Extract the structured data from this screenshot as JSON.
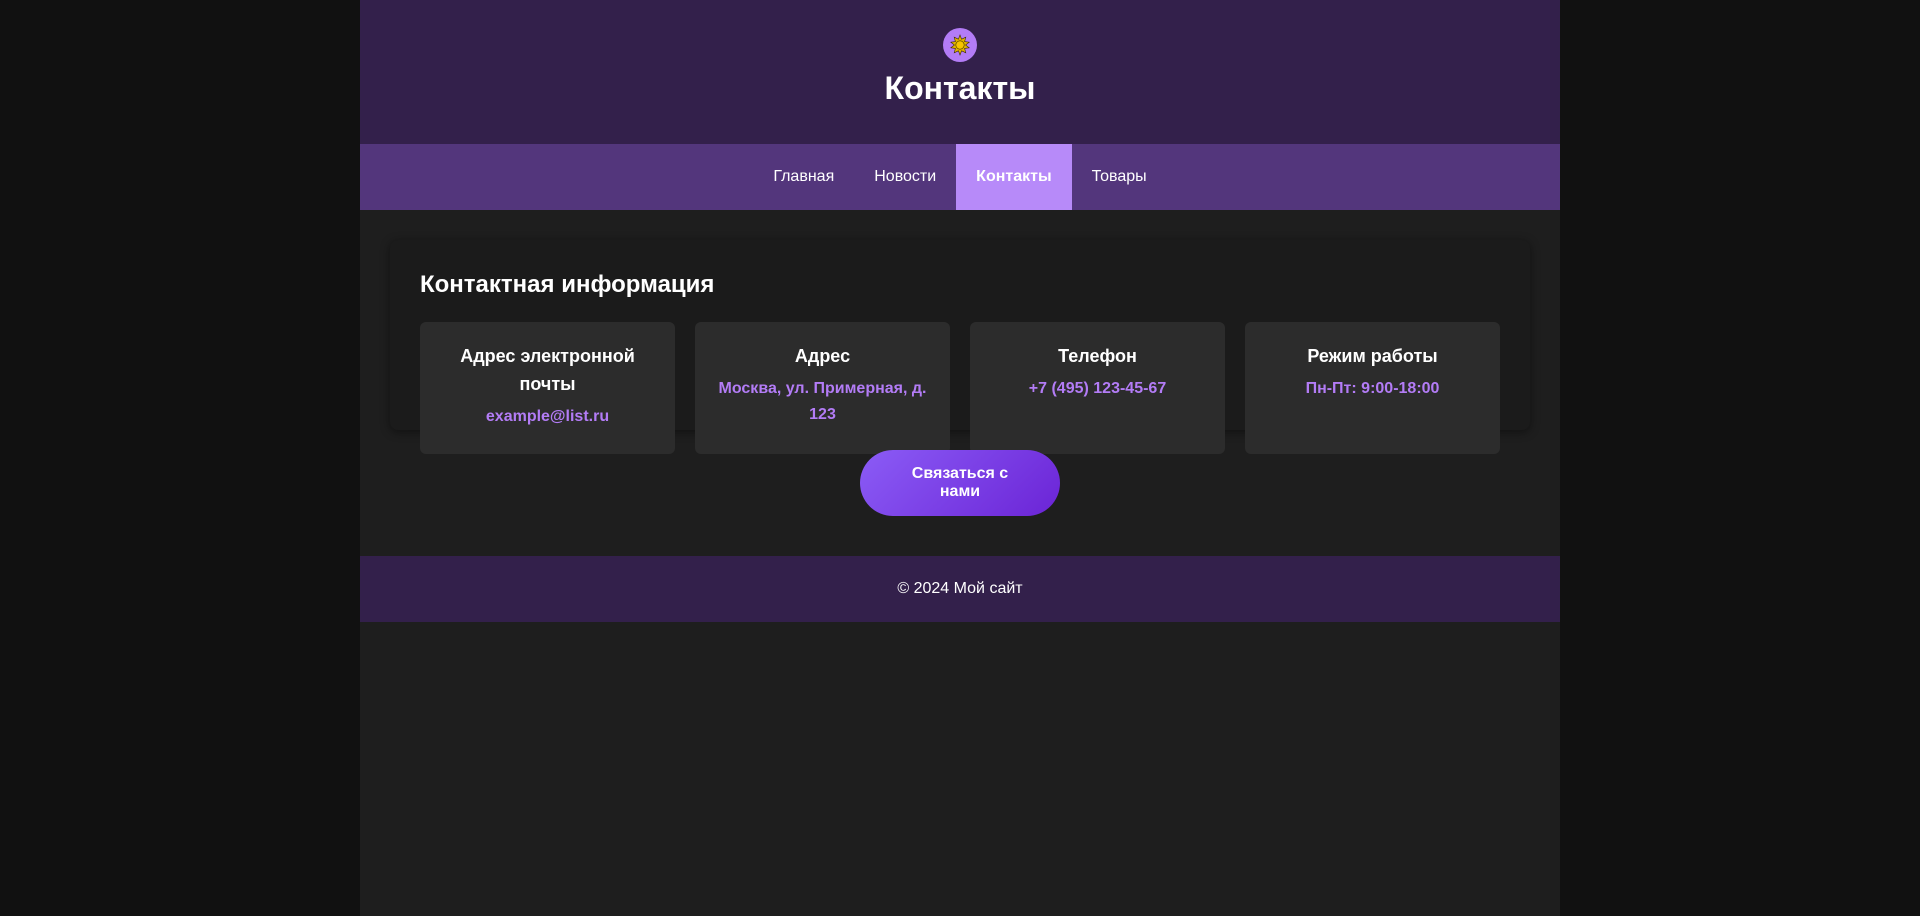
{
  "header": {
    "logo_icon": "sun-icon",
    "title": "Контакты"
  },
  "nav": {
    "items": [
      {
        "label": "Главная",
        "active": false
      },
      {
        "label": "Новости",
        "active": false
      },
      {
        "label": "Контакты",
        "active": true
      },
      {
        "label": "Товары",
        "active": false
      }
    ]
  },
  "contact_card": {
    "title": "Контактная информация",
    "items": [
      {
        "label": "Адрес электронной почты",
        "value": "example@list.ru"
      },
      {
        "label": "Адрес",
        "value": "Москва, ул. Примерная, д. 123"
      },
      {
        "label": "Телефон",
        "value": "+7 (495) 123-45-67"
      },
      {
        "label": "Режим работы",
        "value": "Пн-Пт: 9:00-18:00"
      }
    ]
  },
  "cta": {
    "label": "Связаться с нами"
  },
  "footer": {
    "text": "© 2024 Мой сайт"
  },
  "colors": {
    "accent": "#b37cf6",
    "header_bg": "#33204b",
    "nav_bg": "#53367c",
    "nav_active_bg": "#b78af9",
    "page_bg": "#1e1e1e",
    "outer_bg": "#111111"
  }
}
